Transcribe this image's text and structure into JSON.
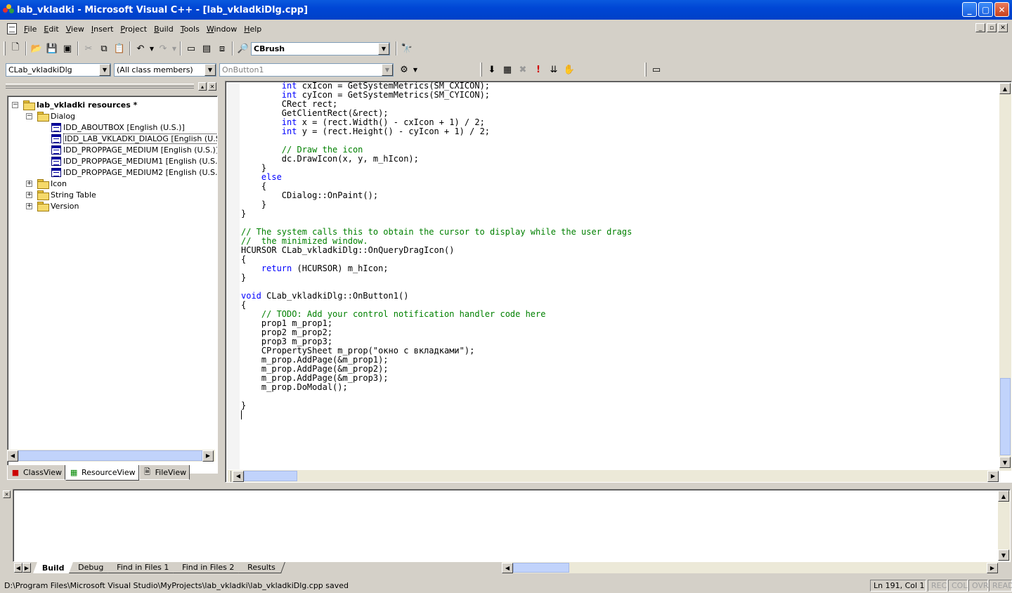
{
  "window": {
    "title": "lab_vkladki - Microsoft Visual C++ - [lab_vkladkiDlg.cpp]",
    "buttons": {
      "minimize": "_",
      "maximize": "▢",
      "close": "✕"
    }
  },
  "menu": {
    "items": [
      {
        "hot": "F",
        "rest": "ile"
      },
      {
        "hot": "E",
        "rest": "dit"
      },
      {
        "hot": "V",
        "rest": "iew"
      },
      {
        "hot": "I",
        "rest": "nsert"
      },
      {
        "hot": "P",
        "rest": "roject"
      },
      {
        "hot": "B",
        "rest": "uild"
      },
      {
        "hot": "T",
        "rest": "ools"
      },
      {
        "hot": "W",
        "rest": "indow"
      },
      {
        "hot": "H",
        "rest": "elp"
      }
    ]
  },
  "toolbar": {
    "find_combo": "CBrush",
    "class_combo": "CLab_vkladkiDlg",
    "filter_combo": "(All class members)",
    "member_combo": "OnButton1"
  },
  "workspace": {
    "tree": {
      "root": "lab_vkladki resources *",
      "dialog_folder": "Dialog",
      "dialogs": [
        "IDD_ABOUTBOX [English (U.S.)]",
        "IDD_LAB_VKLADKI_DIALOG [English (U.S.)]",
        "IDD_PROPPAGE_MEDIUM [English (U.S.)]",
        "IDD_PROPPAGE_MEDIUM1 [English (U.S.)]",
        "IDD_PROPPAGE_MEDIUM2 [English (U.S.)]"
      ],
      "folders": [
        "Icon",
        "String Table",
        "Version"
      ]
    },
    "tabs": [
      "ClassView",
      "ResourceView",
      "FileView"
    ]
  },
  "editor": {
    "lines": [
      [
        [
          "",
          "        "
        ],
        [
          "kw",
          "int"
        ],
        [
          "",
          " cxIcon = GetSystemMetrics(SM_CXICON);"
        ]
      ],
      [
        [
          "",
          "        "
        ],
        [
          "kw",
          "int"
        ],
        [
          "",
          " cyIcon = GetSystemMetrics(SM_CYICON);"
        ]
      ],
      [
        [
          "",
          "        CRect rect;"
        ]
      ],
      [
        [
          "",
          "        GetClientRect(&rect);"
        ]
      ],
      [
        [
          "",
          "        "
        ],
        [
          "kw",
          "int"
        ],
        [
          "",
          " x = (rect.Width() - cxIcon + 1) / 2;"
        ]
      ],
      [
        [
          "",
          "        "
        ],
        [
          "kw",
          "int"
        ],
        [
          "",
          " y = (rect.Height() - cyIcon + 1) / 2;"
        ]
      ],
      [
        [
          "",
          ""
        ]
      ],
      [
        [
          "",
          "        "
        ],
        [
          "cm",
          "// Draw the icon"
        ]
      ],
      [
        [
          "",
          "        dc.DrawIcon(x, y, m_hIcon);"
        ]
      ],
      [
        [
          "",
          "    }"
        ]
      ],
      [
        [
          "",
          "    "
        ],
        [
          "kw",
          "else"
        ]
      ],
      [
        [
          "",
          "    {"
        ]
      ],
      [
        [
          "",
          "        CDialog::OnPaint();"
        ]
      ],
      [
        [
          "",
          "    }"
        ]
      ],
      [
        [
          "",
          "}"
        ]
      ],
      [
        [
          "",
          ""
        ]
      ],
      [
        [
          "cm",
          "// The system calls this to obtain the cursor to display while the user drags"
        ]
      ],
      [
        [
          "cm",
          "//  the minimized window."
        ]
      ],
      [
        [
          "",
          "HCURSOR CLab_vkladkiDlg::OnQueryDragIcon()"
        ]
      ],
      [
        [
          "",
          "{"
        ]
      ],
      [
        [
          "",
          "    "
        ],
        [
          "kw",
          "return"
        ],
        [
          "",
          " (HCURSOR) m_hIcon;"
        ]
      ],
      [
        [
          "",
          "}"
        ]
      ],
      [
        [
          "",
          ""
        ]
      ],
      [
        [
          "kw",
          "void"
        ],
        [
          "",
          " CLab_vkladkiDlg::OnButton1()"
        ]
      ],
      [
        [
          "",
          "{"
        ]
      ],
      [
        [
          "",
          "    "
        ],
        [
          "cm",
          "// TODO: Add your control notification handler code here"
        ]
      ],
      [
        [
          "",
          "    prop1 m_prop1;"
        ]
      ],
      [
        [
          "",
          "    prop2 m_prop2;"
        ]
      ],
      [
        [
          "",
          "    prop3 m_prop3;"
        ]
      ],
      [
        [
          "",
          "    CPropertySheet m_prop(\"окно с вкладками\");"
        ]
      ],
      [
        [
          "",
          "    m_prop.AddPage(&m_prop1);"
        ]
      ],
      [
        [
          "",
          "    m_prop.AddPage(&m_prop2);"
        ]
      ],
      [
        [
          "",
          "    m_prop.AddPage(&m_prop3);"
        ]
      ],
      [
        [
          "",
          "    m_prop.DoModal();"
        ]
      ],
      [
        [
          "",
          ""
        ]
      ],
      [
        [
          "",
          "}"
        ]
      ],
      [
        [
          "",
          ""
        ]
      ]
    ]
  },
  "output": {
    "tabs": [
      "Build",
      "Debug",
      "Find in Files 1",
      "Find in Files 2",
      "Results"
    ],
    "active_tab": "Build"
  },
  "status": {
    "message": "D:\\Program Files\\Microsoft Visual Studio\\MyProjects\\lab_vkladki\\lab_vkladkiDlg.cpp saved",
    "position": "Ln 191, Col 1",
    "indicators": [
      "REC",
      "COL",
      "OVR",
      "READ"
    ]
  },
  "colors": {
    "keyword": "#0000ff",
    "comment": "#008000",
    "titlebar": "#0046d5"
  }
}
